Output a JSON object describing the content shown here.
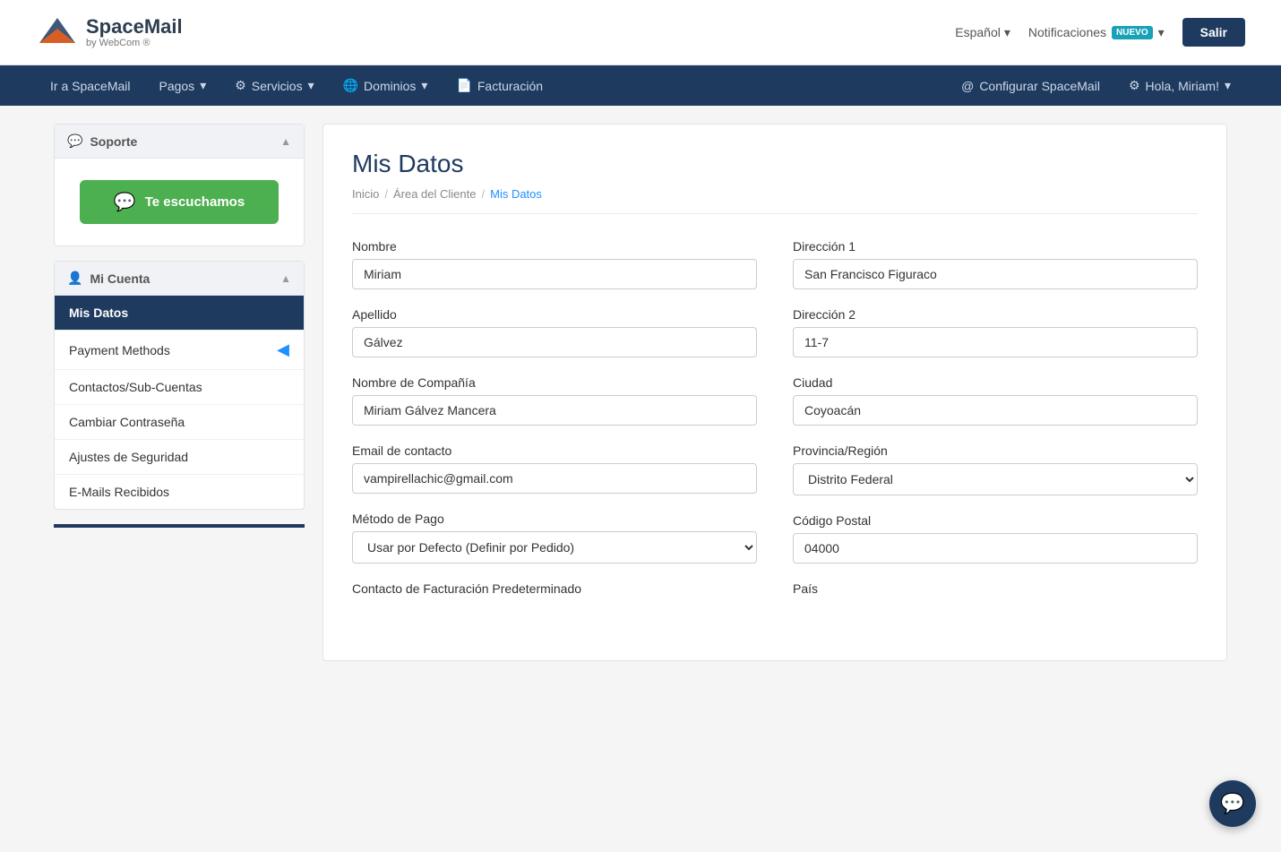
{
  "header": {
    "logo_title": "SpaceMail",
    "logo_registered": "®",
    "logo_subtitle": "by WebCom ®",
    "lang_label": "Español",
    "notif_label": "Notificaciones",
    "nuevo_badge": "NUEVO",
    "salir_label": "Salir"
  },
  "nav": {
    "items_left": [
      {
        "label": "Ir a SpaceMail",
        "icon": ""
      },
      {
        "label": "Pagos",
        "icon": "",
        "has_dropdown": true
      },
      {
        "label": "Servicios",
        "icon": "⚙",
        "has_dropdown": true
      },
      {
        "label": "Dominios",
        "icon": "🌐",
        "has_dropdown": true
      },
      {
        "label": "Facturación",
        "icon": "📄",
        "has_dropdown": false
      }
    ],
    "items_right": [
      {
        "label": "Configurar SpaceMail",
        "icon": "@"
      },
      {
        "label": "Hola, Miriam!",
        "icon": "⚙",
        "has_dropdown": true
      }
    ]
  },
  "sidebar": {
    "soporte_label": "Soporte",
    "whatsapp_label": "Te escuchamos",
    "mi_cuenta_label": "Mi Cuenta",
    "menu_items": [
      {
        "label": "Mis Datos",
        "active": true
      },
      {
        "label": "Payment Methods",
        "active": false,
        "has_arrow": true
      },
      {
        "label": "Contactos/Sub-Cuentas",
        "active": false
      },
      {
        "label": "Cambiar Contraseña",
        "active": false
      },
      {
        "label": "Ajustes de Seguridad",
        "active": false
      },
      {
        "label": "E-Mails Recibidos",
        "active": false
      }
    ]
  },
  "content": {
    "page_title": "Mis Datos",
    "breadcrumb": {
      "inicio": "Inicio",
      "area": "Área del Cliente",
      "current": "Mis Datos"
    },
    "form": {
      "nombre_label": "Nombre",
      "nombre_value": "Miriam",
      "apellido_label": "Apellido",
      "apellido_value": "Gálvez",
      "company_label": "Nombre de Compañía",
      "company_value": "Miriam Gálvez Mancera",
      "email_label": "Email de contacto",
      "email_value": "vampirellachic@gmail.com",
      "metodo_pago_label": "Método de Pago",
      "metodo_pago_value": "Usar por Defecto (Definir por Pedido)",
      "direccion1_label": "Dirección 1",
      "direccion1_value": "San Francisco Figuraco",
      "direccion2_label": "Dirección 2",
      "direccion2_value": "11-7",
      "ciudad_label": "Ciudad",
      "ciudad_value": "Coyoacán",
      "provincia_label": "Provincia/Región",
      "provincia_value": "Distrito Federal",
      "codigo_postal_label": "Código Postal",
      "codigo_postal_value": "04000",
      "contacto_label": "Contacto de Facturación Predeterminado",
      "pais_label": "País"
    }
  }
}
